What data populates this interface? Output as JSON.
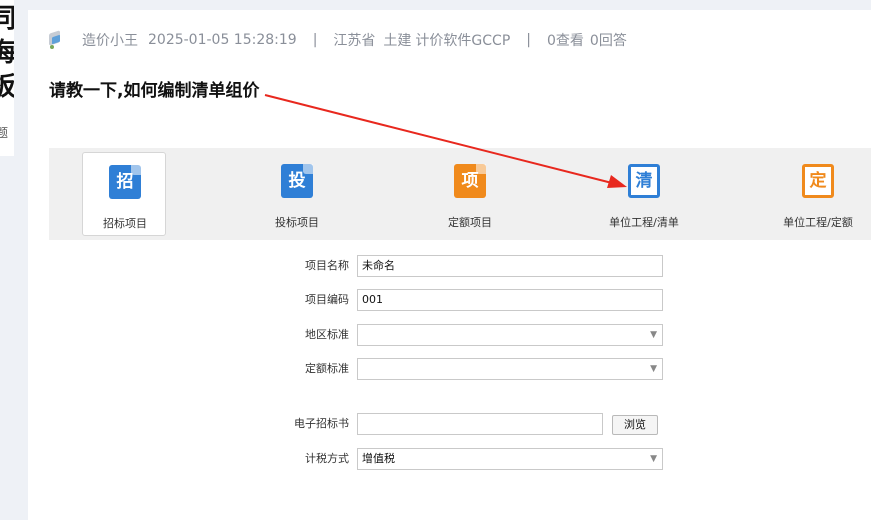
{
  "left_panel": {
    "chars": [
      "同",
      "海",
      "板"
    ],
    "small": "题"
  },
  "post": {
    "author": "造价小王",
    "datetime": "2025-01-05 15:28:19",
    "separator": "|",
    "province": "江苏省",
    "category": "土建",
    "software": "计价软件GCCP",
    "views": "0查看",
    "answers": "0回答",
    "title": "请教一下,如何编制清单组价"
  },
  "toolbar": {
    "items": [
      {
        "label": "招标项目",
        "icon": "招",
        "icon_name": "zhaobiao-icon",
        "color": "#2f7fd6"
      },
      {
        "label": "投标项目",
        "icon": "投",
        "icon_name": "toubiao-icon",
        "color": "#2f7fd6"
      },
      {
        "label": "定额项目",
        "icon": "项",
        "icon_name": "dinge-xiangmu-icon",
        "color": "#f08a1c"
      },
      {
        "label": "单位工程/清单",
        "icon": "清",
        "icon_name": "qingdan-icon",
        "color": "#2f7fd6"
      },
      {
        "label": "单位工程/定额",
        "icon": "定",
        "icon_name": "dinge-icon",
        "color": "#f08a1c"
      }
    ]
  },
  "form": {
    "project_name": {
      "label": "项目名称",
      "value": "未命名"
    },
    "project_code": {
      "label": "项目编码",
      "value": "001"
    },
    "region_std": {
      "label": "地区标准",
      "value": ""
    },
    "quota_std": {
      "label": "定额标准",
      "value": ""
    },
    "e_tender": {
      "label": "电子招标书",
      "value": "",
      "browse": "浏览"
    },
    "tax_method": {
      "label": "计税方式",
      "value": "增值税"
    }
  },
  "dropdown_glyph": "▼",
  "annotation": {
    "color": "#e8281e"
  }
}
